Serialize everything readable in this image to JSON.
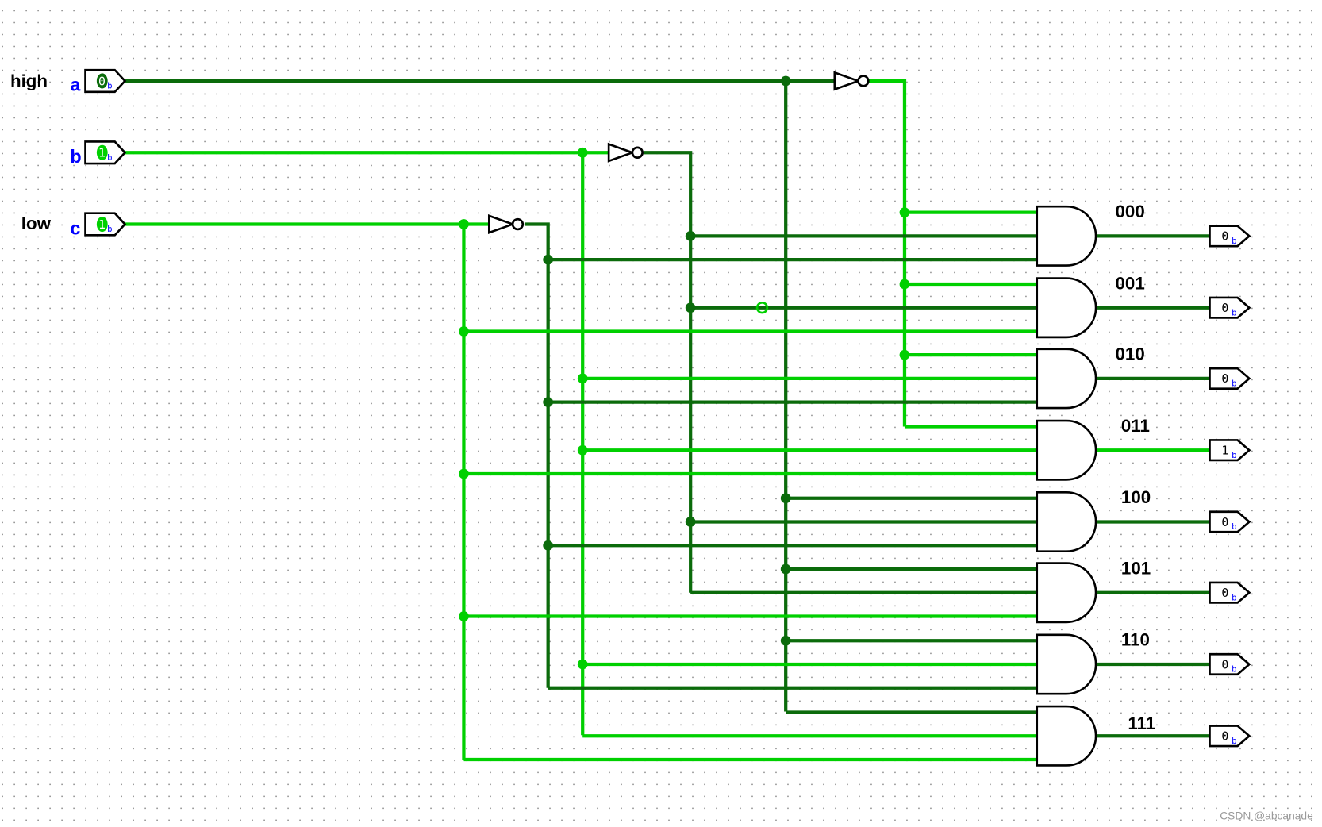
{
  "colors": {
    "wire_low": "#0b6b0b",
    "wire_high": "#00d000",
    "pin_label": "#0000ff",
    "grid_dot": "#888888"
  },
  "labels": {
    "high": "high",
    "low": "low"
  },
  "inputs": [
    {
      "name": "a",
      "value": "0",
      "radix": "b"
    },
    {
      "name": "b",
      "value": "1",
      "radix": "b"
    },
    {
      "name": "c",
      "value": "1",
      "radix": "b"
    }
  ],
  "outputs": [
    {
      "label": "000",
      "value": "0",
      "radix": "b"
    },
    {
      "label": "001",
      "value": "0",
      "radix": "b"
    },
    {
      "label": "010",
      "value": "0",
      "radix": "b"
    },
    {
      "label": "011",
      "value": "1",
      "radix": "b"
    },
    {
      "label": "100",
      "value": "0",
      "radix": "b"
    },
    {
      "label": "101",
      "value": "0",
      "radix": "b"
    },
    {
      "label": "110",
      "value": "0",
      "radix": "b"
    },
    {
      "label": "111",
      "value": "0",
      "radix": "b"
    }
  ],
  "watermark": "CSDN @abcanade"
}
